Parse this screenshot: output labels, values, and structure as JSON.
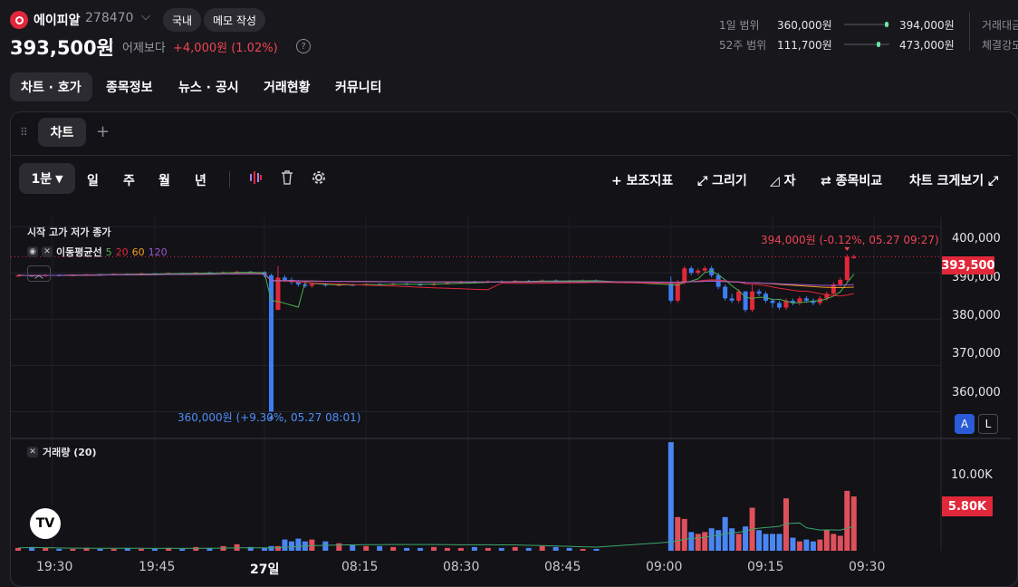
{
  "header": {
    "stock_name": "에이피알",
    "stock_code": "278470",
    "chevron_icon": "chevron-down-icon",
    "badge_domestic": "국내",
    "memo_button": "메모 작성",
    "price": "393,500원",
    "vs_label": "어제보다",
    "change": "+4,000원 (1.02%)",
    "help_icon": "?"
  },
  "ranges": {
    "day_label": "1일 범위",
    "day_low": "360,000원",
    "day_high": "394,000원",
    "day_position": 0.985,
    "week52_label": "52주 범위",
    "week52_low": "111,700원",
    "week52_high": "473,000원",
    "week52_position": 0.78,
    "extra_1": "거래대금",
    "extra_2": "체결강도"
  },
  "tabs": [
    {
      "label": "차트 · 호가",
      "active": true
    },
    {
      "label": "종목정보"
    },
    {
      "label": "뉴스 · 공시"
    },
    {
      "label": "거래현황"
    },
    {
      "label": "커뮤니티"
    }
  ],
  "chart_panel": {
    "tab_label": "차트",
    "add_tab_icon": "+",
    "period_selected": "1분",
    "periods": [
      "일",
      "주",
      "월",
      "년"
    ],
    "toolbar_right": [
      "+ 보조지표",
      "⤢ 그리기",
      "◿ 자",
      "⇄ 종목비교",
      "차트 크게보기 ⤢"
    ],
    "ohlc_legend": "시작 고가 저가 종가",
    "ma_label": "이동평균선",
    "ma_periods": [
      {
        "label": "5",
        "color": "#4caf50"
      },
      {
        "label": "20",
        "color": "#e0283a"
      },
      {
        "label": "60",
        "color": "#f59f1b"
      },
      {
        "label": "120",
        "color": "#9b59d0"
      }
    ],
    "high_annotation": "394,000원 (-0.12%, 05.27 09:27)",
    "low_annotation": "360,000원 (+9.30%, 05.27 08:01)",
    "current_price_tag": "393,500",
    "auto_button": "A",
    "log_button": "L",
    "volume_legend": "거래량 (20)",
    "volume_tag": "5.80K",
    "tv_logo": "TV"
  },
  "chart_data": {
    "type": "candlestick",
    "title": "",
    "price_axis": {
      "ticks": [
        "400,000",
        "390,000",
        "380,000",
        "370,000",
        "360,000"
      ],
      "range": [
        355000,
        402000
      ]
    },
    "volume_axis": {
      "ticks": [
        "10.00K"
      ],
      "range": [
        0,
        12000
      ]
    },
    "time_ticks": [
      "19:30",
      "19:45",
      "27일",
      "08:15",
      "08:30",
      "08:45",
      "09:00",
      "09:15",
      "09:30"
    ],
    "current_price": 393500,
    "day_high": 394000,
    "day_low": 360000,
    "candles": [
      {
        "t": "19:25",
        "o": 389500,
        "c": 389500,
        "h": 389700,
        "l": 389300,
        "v": 300
      },
      {
        "t": "19:27",
        "o": 389500,
        "c": 389300,
        "h": 389600,
        "l": 389200,
        "v": 400
      },
      {
        "t": "19:29",
        "o": 389300,
        "c": 389600,
        "h": 389700,
        "l": 389200,
        "v": 300
      },
      {
        "t": "19:31",
        "o": 389600,
        "c": 389500,
        "h": 389700,
        "l": 389400,
        "v": 200
      },
      {
        "t": "19:33",
        "o": 389500,
        "c": 389600,
        "h": 389700,
        "l": 389400,
        "v": 200
      },
      {
        "t": "19:35",
        "o": 389600,
        "c": 389700,
        "h": 389800,
        "l": 389500,
        "v": 300
      },
      {
        "t": "19:37",
        "o": 389700,
        "c": 389600,
        "h": 389800,
        "l": 389500,
        "v": 200
      },
      {
        "t": "19:39",
        "o": 389600,
        "c": 389800,
        "h": 389900,
        "l": 389500,
        "v": 200
      },
      {
        "t": "19:41",
        "o": 389800,
        "c": 389700,
        "h": 389900,
        "l": 389600,
        "v": 300
      },
      {
        "t": "19:43",
        "o": 389700,
        "c": 389900,
        "h": 390000,
        "l": 389600,
        "v": 200
      },
      {
        "t": "19:45",
        "o": 389900,
        "c": 389800,
        "h": 390000,
        "l": 389700,
        "v": 200
      },
      {
        "t": "19:47",
        "o": 389800,
        "c": 390000,
        "h": 390100,
        "l": 389700,
        "v": 300
      },
      {
        "t": "19:49",
        "o": 390000,
        "c": 389900,
        "h": 390100,
        "l": 389800,
        "v": 200
      },
      {
        "t": "19:51",
        "o": 389900,
        "c": 390100,
        "h": 390200,
        "l": 389800,
        "v": 400
      },
      {
        "t": "19:53",
        "o": 390100,
        "c": 390000,
        "h": 390300,
        "l": 389900,
        "v": 300
      },
      {
        "t": "19:55",
        "o": 390000,
        "c": 390200,
        "h": 390300,
        "l": 389900,
        "v": 500
      },
      {
        "t": "19:57",
        "o": 390200,
        "c": 390300,
        "h": 390400,
        "l": 390100,
        "v": 700
      },
      {
        "t": "19:59",
        "o": 390300,
        "c": 390200,
        "h": 390400,
        "l": 390100,
        "v": 400
      },
      {
        "t": "08:00",
        "o": 390200,
        "c": 389500,
        "h": 390400,
        "l": 389000,
        "v": 300
      },
      {
        "t": "08:01",
        "o": 389500,
        "c": 360000,
        "h": 389800,
        "l": 360000,
        "v": 500
      },
      {
        "t": "08:02",
        "o": 382000,
        "c": 389000,
        "h": 391500,
        "l": 382000,
        "v": 500
      },
      {
        "t": "08:03",
        "o": 389000,
        "c": 388500,
        "h": 389500,
        "l": 388000,
        "v": 1200
      },
      {
        "t": "08:04",
        "o": 388500,
        "c": 388000,
        "h": 389000,
        "l": 387500,
        "v": 1000
      },
      {
        "t": "08:05",
        "o": 388000,
        "c": 387500,
        "h": 388500,
        "l": 387000,
        "v": 1300
      },
      {
        "t": "08:06",
        "o": 387500,
        "c": 387200,
        "h": 388000,
        "l": 386800,
        "v": 1000
      },
      {
        "t": "08:07",
        "o": 387200,
        "c": 387600,
        "h": 388000,
        "l": 386800,
        "v": 1200
      },
      {
        "t": "08:09",
        "o": 387600,
        "c": 387300,
        "h": 387900,
        "l": 387000,
        "v": 1000
      },
      {
        "t": "08:11",
        "o": 387300,
        "c": 387500,
        "h": 387800,
        "l": 387100,
        "v": 800
      },
      {
        "t": "08:13",
        "o": 387500,
        "c": 387400,
        "h": 387700,
        "l": 387200,
        "v": 600
      },
      {
        "t": "08:15",
        "o": 387400,
        "c": 387600,
        "h": 387800,
        "l": 387200,
        "v": 500
      },
      {
        "t": "08:17",
        "o": 387600,
        "c": 387500,
        "h": 387800,
        "l": 387300,
        "v": 500
      },
      {
        "t": "08:19",
        "o": 387500,
        "c": 387700,
        "h": 387900,
        "l": 387300,
        "v": 400
      },
      {
        "t": "08:21",
        "o": 387700,
        "c": 387600,
        "h": 387900,
        "l": 387400,
        "v": 300
      },
      {
        "t": "08:23",
        "o": 387600,
        "c": 387400,
        "h": 387800,
        "l": 387200,
        "v": 300
      },
      {
        "t": "08:25",
        "o": 387400,
        "c": 387700,
        "h": 387900,
        "l": 387200,
        "v": 400
      },
      {
        "t": "08:27",
        "o": 387700,
        "c": 387900,
        "h": 388100,
        "l": 387500,
        "v": 300
      },
      {
        "t": "08:29",
        "o": 387900,
        "c": 388100,
        "h": 388300,
        "l": 387700,
        "v": 300
      },
      {
        "t": "08:31",
        "o": 388100,
        "c": 388000,
        "h": 388300,
        "l": 387800,
        "v": 400
      },
      {
        "t": "08:33",
        "o": 388000,
        "c": 388200,
        "h": 388400,
        "l": 387800,
        "v": 300
      },
      {
        "t": "08:35",
        "o": 388200,
        "c": 388100,
        "h": 388400,
        "l": 387900,
        "v": 300
      },
      {
        "t": "08:37",
        "o": 388100,
        "c": 388300,
        "h": 388500,
        "l": 387900,
        "v": 400
      },
      {
        "t": "08:39",
        "o": 388300,
        "c": 388200,
        "h": 388500,
        "l": 388000,
        "v": 300
      },
      {
        "t": "08:41",
        "o": 388200,
        "c": 388400,
        "h": 388600,
        "l": 388000,
        "v": 500
      },
      {
        "t": "08:43",
        "o": 388400,
        "c": 388300,
        "h": 388600,
        "l": 388100,
        "v": 400
      },
      {
        "t": "08:45",
        "o": 388300,
        "c": 388200,
        "h": 388500,
        "l": 388000,
        "v": 300
      },
      {
        "t": "08:47",
        "o": 388200,
        "c": 388400,
        "h": 388600,
        "l": 388000,
        "v": 200
      },
      {
        "t": "08:49",
        "o": 388400,
        "c": 388300,
        "h": 388600,
        "l": 388100,
        "v": 200
      },
      {
        "t": "09:00",
        "o": 388000,
        "c": 384000,
        "h": 389200,
        "l": 383500,
        "v": 11600
      },
      {
        "t": "09:01",
        "o": 384000,
        "c": 388000,
        "h": 388500,
        "l": 383500,
        "v": 3600
      },
      {
        "t": "09:02",
        "o": 388000,
        "c": 391000,
        "h": 391500,
        "l": 387500,
        "v": 3400
      },
      {
        "t": "09:03",
        "o": 391000,
        "c": 390000,
        "h": 391500,
        "l": 389500,
        "v": 2000
      },
      {
        "t": "09:04",
        "o": 390000,
        "c": 390500,
        "h": 391000,
        "l": 389500,
        "v": 1800
      },
      {
        "t": "09:05",
        "o": 390500,
        "c": 391000,
        "h": 391500,
        "l": 390000,
        "v": 2000
      },
      {
        "t": "09:06",
        "o": 391000,
        "c": 389500,
        "h": 391500,
        "l": 389000,
        "v": 2400
      },
      {
        "t": "09:07",
        "o": 389500,
        "c": 387000,
        "h": 390000,
        "l": 386500,
        "v": 2200
      },
      {
        "t": "09:08",
        "o": 387000,
        "c": 384500,
        "h": 387500,
        "l": 384000,
        "v": 3600
      },
      {
        "t": "09:09",
        "o": 384500,
        "c": 384000,
        "h": 385500,
        "l": 383500,
        "v": 2400
      },
      {
        "t": "09:10",
        "o": 384000,
        "c": 386000,
        "h": 386500,
        "l": 383500,
        "v": 1800
      },
      {
        "t": "09:11",
        "o": 386000,
        "c": 382000,
        "h": 386000,
        "l": 381500,
        "v": 2600
      },
      {
        "t": "09:12",
        "o": 382000,
        "c": 386000,
        "h": 387500,
        "l": 381500,
        "v": 4600
      },
      {
        "t": "09:13",
        "o": 386000,
        "c": 385500,
        "h": 386500,
        "l": 385000,
        "v": 2200
      },
      {
        "t": "09:14",
        "o": 385500,
        "c": 384000,
        "h": 386000,
        "l": 383500,
        "v": 1800
      },
      {
        "t": "09:15",
        "o": 384000,
        "c": 383500,
        "h": 384500,
        "l": 382500,
        "v": 1800
      },
      {
        "t": "09:16",
        "o": 383500,
        "c": 382500,
        "h": 384000,
        "l": 382000,
        "v": 1800
      },
      {
        "t": "09:17",
        "o": 382500,
        "c": 384000,
        "h": 384500,
        "l": 382000,
        "v": 5600
      },
      {
        "t": "09:18",
        "o": 384000,
        "c": 383500,
        "h": 384500,
        "l": 383000,
        "v": 1400
      },
      {
        "t": "09:19",
        "o": 383500,
        "c": 384500,
        "h": 385000,
        "l": 383000,
        "v": 1000
      },
      {
        "t": "09:20",
        "o": 384500,
        "c": 384000,
        "h": 385000,
        "l": 383500,
        "v": 1200
      },
      {
        "t": "09:21",
        "o": 384000,
        "c": 383500,
        "h": 384500,
        "l": 383000,
        "v": 1000
      },
      {
        "t": "09:22",
        "o": 383500,
        "c": 384500,
        "h": 385000,
        "l": 383000,
        "v": 1200
      },
      {
        "t": "09:23",
        "o": 384500,
        "c": 385500,
        "h": 386000,
        "l": 384000,
        "v": 2200
      },
      {
        "t": "09:24",
        "o": 385500,
        "c": 387500,
        "h": 388000,
        "l": 385000,
        "v": 1800
      },
      {
        "t": "09:25",
        "o": 387500,
        "c": 388500,
        "h": 389000,
        "l": 387000,
        "v": 1600
      },
      {
        "t": "09:26",
        "o": 388500,
        "c": 393500,
        "h": 394000,
        "l": 388000,
        "v": 6400
      },
      {
        "t": "09:27",
        "o": 393500,
        "c": 393500,
        "h": 394000,
        "l": 393000,
        "v": 5800
      }
    ]
  }
}
